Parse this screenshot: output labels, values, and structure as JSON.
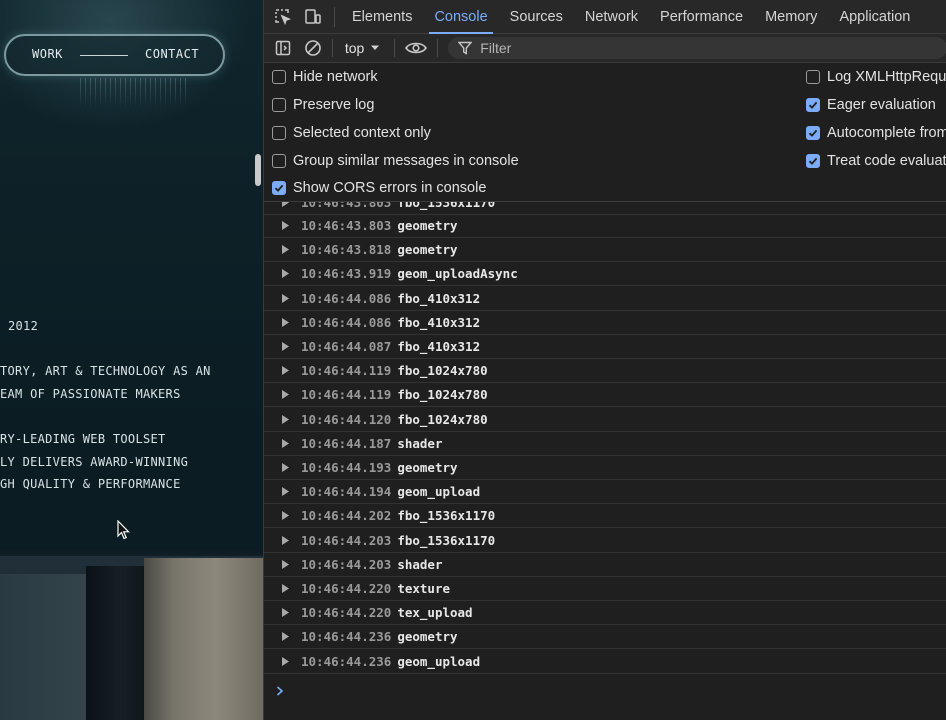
{
  "website": {
    "nav": {
      "work": "WORK",
      "contact": "CONTACT"
    },
    "year": "2012",
    "lines": [
      "TORY, ART & TECHNOLOGY AS AN",
      "EAM OF PASSIONATE MAKERS",
      "RY-LEADING WEB TOOLSET",
      "LY DELIVERS AWARD-WINNING",
      "GH QUALITY & PERFORMANCE"
    ]
  },
  "devtools": {
    "tabs": [
      "Elements",
      "Console",
      "Sources",
      "Network",
      "Performance",
      "Memory",
      "Application"
    ],
    "active_tab": "Console",
    "toolbar": {
      "context": "top",
      "filter_placeholder": "Filter"
    },
    "settings": {
      "left": [
        {
          "label": "Hide network",
          "checked": false
        },
        {
          "label": "Preserve log",
          "checked": false
        },
        {
          "label": "Selected context only",
          "checked": false
        },
        {
          "label": "Group similar messages in console",
          "checked": false
        },
        {
          "label": "Show CORS errors in console",
          "checked": true
        }
      ],
      "right": [
        {
          "label": "Log XMLHttpRequ",
          "checked": false
        },
        {
          "label": "Eager evaluation",
          "checked": true
        },
        {
          "label": "Autocomplete from",
          "checked": true
        },
        {
          "label": "Treat code evaluat",
          "checked": true
        }
      ]
    },
    "partial_row": {
      "timestamp": "10:46:43.803",
      "message": "fbo_1536x1170"
    },
    "log_rows": [
      {
        "timestamp": "10:46:43.803",
        "message": "geometry"
      },
      {
        "timestamp": "10:46:43.818",
        "message": "geometry"
      },
      {
        "timestamp": "10:46:43.919",
        "message": "geom_uploadAsync"
      },
      {
        "timestamp": "10:46:44.086",
        "message": "fbo_410x312"
      },
      {
        "timestamp": "10:46:44.086",
        "message": "fbo_410x312"
      },
      {
        "timestamp": "10:46:44.087",
        "message": "fbo_410x312"
      },
      {
        "timestamp": "10:46:44.119",
        "message": "fbo_1024x780"
      },
      {
        "timestamp": "10:46:44.119",
        "message": "fbo_1024x780"
      },
      {
        "timestamp": "10:46:44.120",
        "message": "fbo_1024x780"
      },
      {
        "timestamp": "10:46:44.187",
        "message": "shader"
      },
      {
        "timestamp": "10:46:44.193",
        "message": "geometry"
      },
      {
        "timestamp": "10:46:44.194",
        "message": "geom_upload"
      },
      {
        "timestamp": "10:46:44.202",
        "message": "fbo_1536x1170"
      },
      {
        "timestamp": "10:46:44.203",
        "message": "fbo_1536x1170"
      },
      {
        "timestamp": "10:46:44.203",
        "message": "shader"
      },
      {
        "timestamp": "10:46:44.220",
        "message": "texture"
      },
      {
        "timestamp": "10:46:44.220",
        "message": "tex_upload"
      },
      {
        "timestamp": "10:46:44.236",
        "message": "geometry"
      },
      {
        "timestamp": "10:46:44.236",
        "message": "geom_upload"
      }
    ]
  },
  "colors": {
    "accent": "#7cacf8",
    "panel": "#1f1f1f",
    "timestamp": "#9a9a9a"
  }
}
